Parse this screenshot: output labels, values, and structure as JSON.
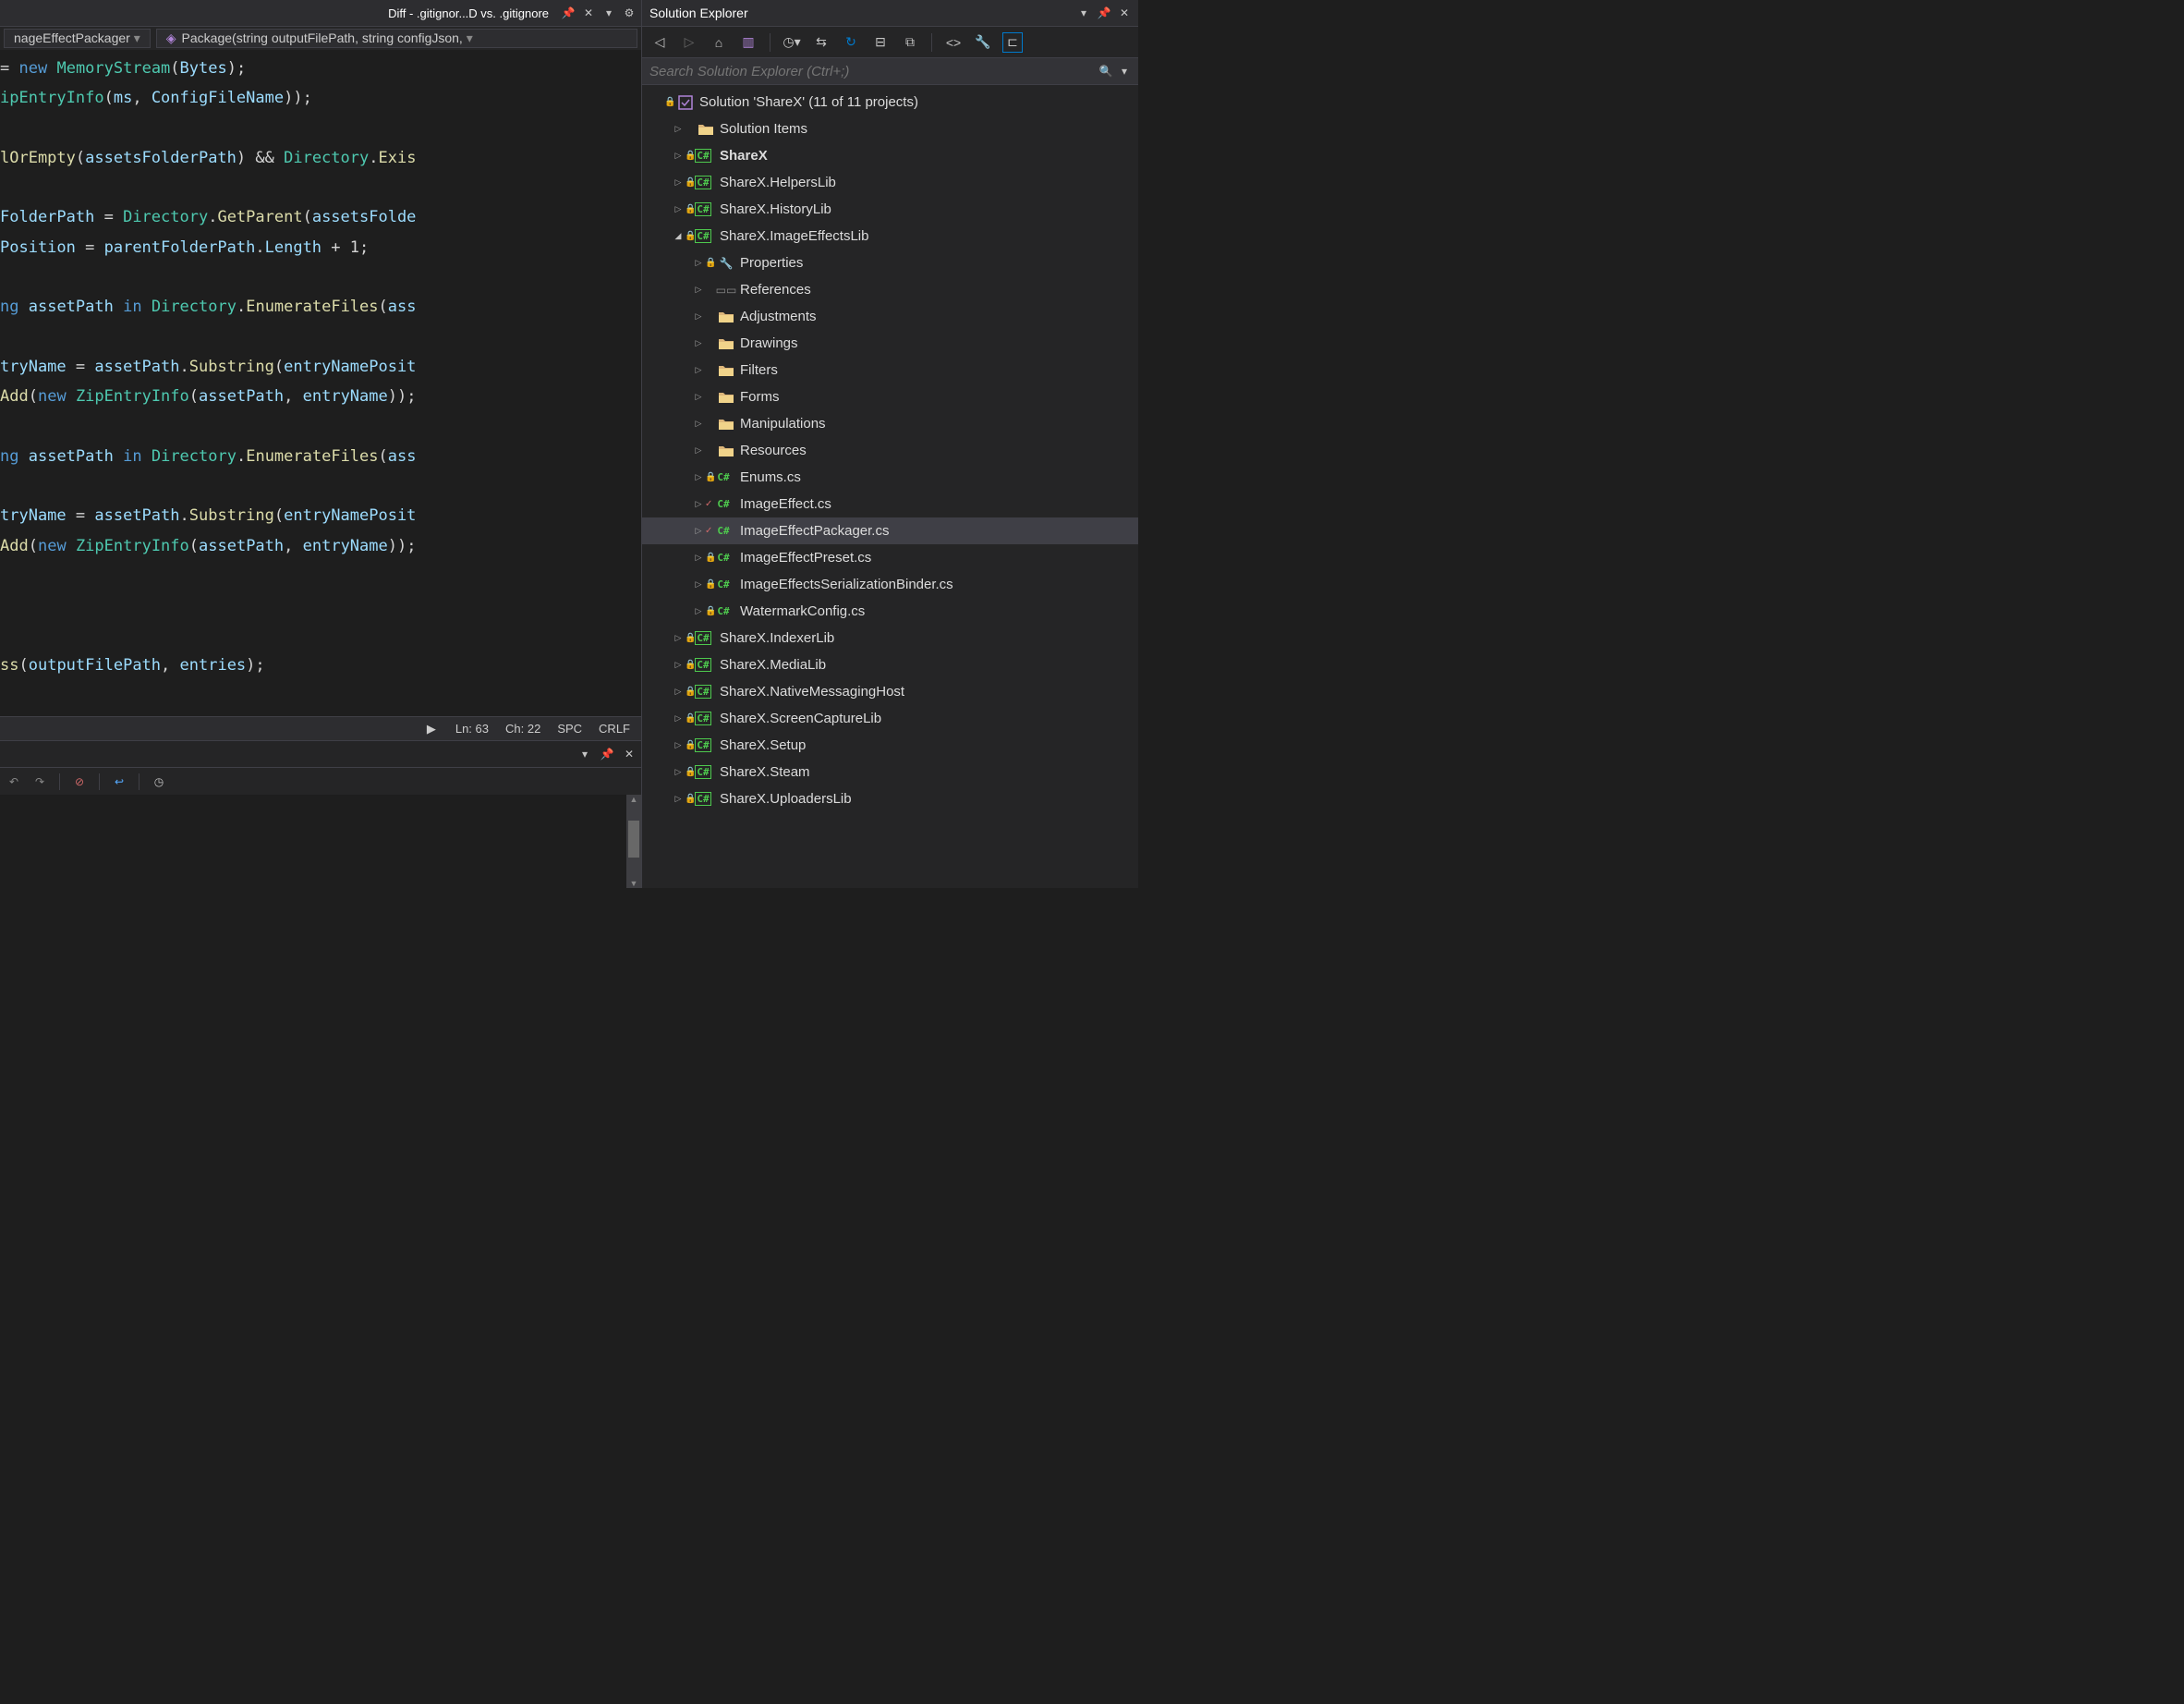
{
  "tab": {
    "title": "Diff - .gitignor...D vs. .gitignore"
  },
  "nav": {
    "class": "nageEffectPackager",
    "method": "Package(string outputFilePath, string configJson,"
  },
  "editor": {
    "lines": [
      {
        "indent": 2,
        "tokens": [
          [
            "p",
            "="
          ],
          [
            "o",
            " "
          ],
          [
            "k",
            "new"
          ],
          [
            "o",
            " "
          ],
          [
            "t",
            "MemoryStream"
          ],
          [
            "p",
            "("
          ],
          [
            "v",
            "Bytes"
          ],
          [
            "p",
            ");"
          ]
        ]
      },
      {
        "indent": 0,
        "tokens": [
          [
            "t",
            "ipEntryInfo"
          ],
          [
            "p",
            "("
          ],
          [
            "v",
            "ms"
          ],
          [
            "p",
            ", "
          ],
          [
            "v",
            "ConfigFileName"
          ],
          [
            "p",
            "));"
          ]
        ]
      },
      {
        "indent": 0,
        "tokens": [
          [
            "o",
            " "
          ]
        ]
      },
      {
        "indent": 0,
        "tokens": [
          [
            "m",
            "lOrEmpty"
          ],
          [
            "p",
            "("
          ],
          [
            "v",
            "assetsFolderPath"
          ],
          [
            "p",
            ") "
          ],
          [
            "o",
            "&& "
          ],
          [
            "t",
            "Directory"
          ],
          [
            "p",
            "."
          ],
          [
            "m",
            "Exis"
          ]
        ]
      },
      {
        "indent": 0,
        "tokens": [
          [
            "o",
            " "
          ]
        ]
      },
      {
        "indent": 0,
        "tokens": [
          [
            "v",
            "FolderPath"
          ],
          [
            "o",
            " = "
          ],
          [
            "t",
            "Directory"
          ],
          [
            "p",
            "."
          ],
          [
            "m",
            "GetParent"
          ],
          [
            "p",
            "("
          ],
          [
            "v",
            "assetsFolde"
          ]
        ]
      },
      {
        "indent": 0,
        "tokens": [
          [
            "v",
            "Position"
          ],
          [
            "o",
            " = "
          ],
          [
            "v",
            "parentFolderPath"
          ],
          [
            "p",
            "."
          ],
          [
            "v",
            "Length"
          ],
          [
            "o",
            " + "
          ],
          [
            "p",
            "1;"
          ]
        ]
      },
      {
        "indent": 0,
        "tokens": [
          [
            "o",
            " "
          ]
        ]
      },
      {
        "indent": 0,
        "tokens": [
          [
            "k",
            "ng"
          ],
          [
            "o",
            " "
          ],
          [
            "v",
            "assetPath"
          ],
          [
            "o",
            " "
          ],
          [
            "k",
            "in"
          ],
          [
            "o",
            " "
          ],
          [
            "t",
            "Directory"
          ],
          [
            "p",
            "."
          ],
          [
            "m",
            "EnumerateFiles"
          ],
          [
            "p",
            "("
          ],
          [
            "v",
            "ass"
          ]
        ]
      },
      {
        "indent": 0,
        "tokens": [
          [
            "o",
            " "
          ]
        ]
      },
      {
        "indent": 0,
        "tokens": [
          [
            "v",
            "tryName"
          ],
          [
            "o",
            " = "
          ],
          [
            "v",
            "assetPath"
          ],
          [
            "p",
            "."
          ],
          [
            "m",
            "Substring"
          ],
          [
            "p",
            "("
          ],
          [
            "v",
            "entryNamePosit"
          ]
        ]
      },
      {
        "indent": 0,
        "tokens": [
          [
            "m",
            "Add"
          ],
          [
            "p",
            "("
          ],
          [
            "k",
            "new"
          ],
          [
            "o",
            " "
          ],
          [
            "t",
            "ZipEntryInfo"
          ],
          [
            "p",
            "("
          ],
          [
            "v",
            "assetPath"
          ],
          [
            "p",
            ", "
          ],
          [
            "v",
            "entryName"
          ],
          [
            "p",
            "));"
          ]
        ]
      },
      {
        "indent": 0,
        "tokens": [
          [
            "o",
            " "
          ]
        ]
      },
      {
        "indent": 0,
        "tokens": [
          [
            "k",
            "ng"
          ],
          [
            "o",
            " "
          ],
          [
            "v",
            "assetPath"
          ],
          [
            "o",
            " "
          ],
          [
            "k",
            "in"
          ],
          [
            "o",
            " "
          ],
          [
            "t",
            "Directory"
          ],
          [
            "p",
            "."
          ],
          [
            "m",
            "EnumerateFiles"
          ],
          [
            "p",
            "("
          ],
          [
            "v",
            "ass"
          ]
        ]
      },
      {
        "indent": 0,
        "tokens": [
          [
            "o",
            " "
          ]
        ]
      },
      {
        "indent": 0,
        "tokens": [
          [
            "v",
            "tryName"
          ],
          [
            "o",
            " = "
          ],
          [
            "v",
            "assetPath"
          ],
          [
            "p",
            "."
          ],
          [
            "m",
            "Substring"
          ],
          [
            "p",
            "("
          ],
          [
            "v",
            "entryNamePosit"
          ]
        ]
      },
      {
        "indent": 0,
        "tokens": [
          [
            "m",
            "Add"
          ],
          [
            "p",
            "("
          ],
          [
            "k",
            "new"
          ],
          [
            "o",
            " "
          ],
          [
            "t",
            "ZipEntryInfo"
          ],
          [
            "p",
            "("
          ],
          [
            "v",
            "assetPath"
          ],
          [
            "p",
            ", "
          ],
          [
            "v",
            "entryName"
          ],
          [
            "p",
            "));"
          ]
        ]
      },
      {
        "indent": 0,
        "tokens": [
          [
            "o",
            " "
          ]
        ]
      },
      {
        "indent": 0,
        "tokens": [
          [
            "o",
            " "
          ]
        ]
      },
      {
        "indent": 0,
        "tokens": [
          [
            "o",
            " "
          ]
        ]
      },
      {
        "indent": 0,
        "tokens": [
          [
            "m",
            "ss"
          ],
          [
            "p",
            "("
          ],
          [
            "v",
            "outputFilePath"
          ],
          [
            "p",
            ", "
          ],
          [
            "v",
            "entries"
          ],
          [
            "p",
            ");"
          ]
        ]
      }
    ]
  },
  "status": {
    "ln": "Ln: 63",
    "ch": "Ch: 22",
    "spc": "SPC",
    "crlf": "CRLF"
  },
  "explorer": {
    "title": "Solution Explorer",
    "search_placeholder": "Search Solution Explorer (Ctrl+;)",
    "solution": "Solution 'ShareX' (11 of 11 projects)",
    "tree": [
      {
        "depth": 0,
        "arrow": "none",
        "lock": true,
        "icon": "solution",
        "label": "Solution 'ShareX' (11 of 11 projects)",
        "bold": false
      },
      {
        "depth": 1,
        "arrow": "closed",
        "lock": false,
        "icon": "folder",
        "label": "Solution Items",
        "bold": false
      },
      {
        "depth": 1,
        "arrow": "closed",
        "lock": true,
        "icon": "csproj",
        "label": "ShareX",
        "bold": true
      },
      {
        "depth": 1,
        "arrow": "closed",
        "lock": true,
        "icon": "csproj",
        "label": "ShareX.HelpersLib",
        "bold": false
      },
      {
        "depth": 1,
        "arrow": "closed",
        "lock": true,
        "icon": "csproj",
        "label": "ShareX.HistoryLib",
        "bold": false
      },
      {
        "depth": 1,
        "arrow": "open",
        "lock": true,
        "icon": "csproj",
        "label": "ShareX.ImageEffectsLib",
        "bold": false
      },
      {
        "depth": 2,
        "arrow": "closed",
        "lock": true,
        "icon": "wrench",
        "label": "Properties",
        "bold": false
      },
      {
        "depth": 2,
        "arrow": "closed",
        "lock": false,
        "icon": "ref",
        "label": "References",
        "bold": false
      },
      {
        "depth": 2,
        "arrow": "closed",
        "lock": false,
        "icon": "folder",
        "label": "Adjustments",
        "bold": false
      },
      {
        "depth": 2,
        "arrow": "closed",
        "lock": false,
        "icon": "folder",
        "label": "Drawings",
        "bold": false
      },
      {
        "depth": 2,
        "arrow": "closed",
        "lock": false,
        "icon": "folder",
        "label": "Filters",
        "bold": false
      },
      {
        "depth": 2,
        "arrow": "closed",
        "lock": false,
        "icon": "folder",
        "label": "Forms",
        "bold": false
      },
      {
        "depth": 2,
        "arrow": "closed",
        "lock": false,
        "icon": "folder",
        "label": "Manipulations",
        "bold": false
      },
      {
        "depth": 2,
        "arrow": "closed",
        "lock": false,
        "icon": "folder",
        "label": "Resources",
        "bold": false
      },
      {
        "depth": 2,
        "arrow": "closed",
        "lock": true,
        "icon": "cs",
        "label": "Enums.cs",
        "bold": false
      },
      {
        "depth": 2,
        "arrow": "closed",
        "check": true,
        "icon": "cs",
        "label": "ImageEffect.cs",
        "bold": false
      },
      {
        "depth": 2,
        "arrow": "closed",
        "check": true,
        "icon": "cs",
        "label": "ImageEffectPackager.cs",
        "bold": false,
        "selected": true
      },
      {
        "depth": 2,
        "arrow": "closed",
        "lock": true,
        "icon": "cs",
        "label": "ImageEffectPreset.cs",
        "bold": false
      },
      {
        "depth": 2,
        "arrow": "closed",
        "lock": true,
        "icon": "cs",
        "label": "ImageEffectsSerializationBinder.cs",
        "bold": false
      },
      {
        "depth": 2,
        "arrow": "closed",
        "lock": true,
        "icon": "cs",
        "label": "WatermarkConfig.cs",
        "bold": false
      },
      {
        "depth": 1,
        "arrow": "closed",
        "lock": true,
        "icon": "csproj",
        "label": "ShareX.IndexerLib",
        "bold": false
      },
      {
        "depth": 1,
        "arrow": "closed",
        "lock": true,
        "icon": "csproj",
        "label": "ShareX.MediaLib",
        "bold": false
      },
      {
        "depth": 1,
        "arrow": "closed",
        "lock": true,
        "icon": "csproj",
        "label": "ShareX.NativeMessagingHost",
        "bold": false
      },
      {
        "depth": 1,
        "arrow": "closed",
        "lock": true,
        "icon": "csproj",
        "label": "ShareX.ScreenCaptureLib",
        "bold": false
      },
      {
        "depth": 1,
        "arrow": "closed",
        "lock": true,
        "icon": "csproj",
        "label": "ShareX.Setup",
        "bold": false
      },
      {
        "depth": 1,
        "arrow": "closed",
        "lock": true,
        "icon": "csproj",
        "label": "ShareX.Steam",
        "bold": false
      },
      {
        "depth": 1,
        "arrow": "closed",
        "lock": true,
        "icon": "csproj",
        "label": "ShareX.UploadersLib",
        "bold": false
      }
    ]
  }
}
